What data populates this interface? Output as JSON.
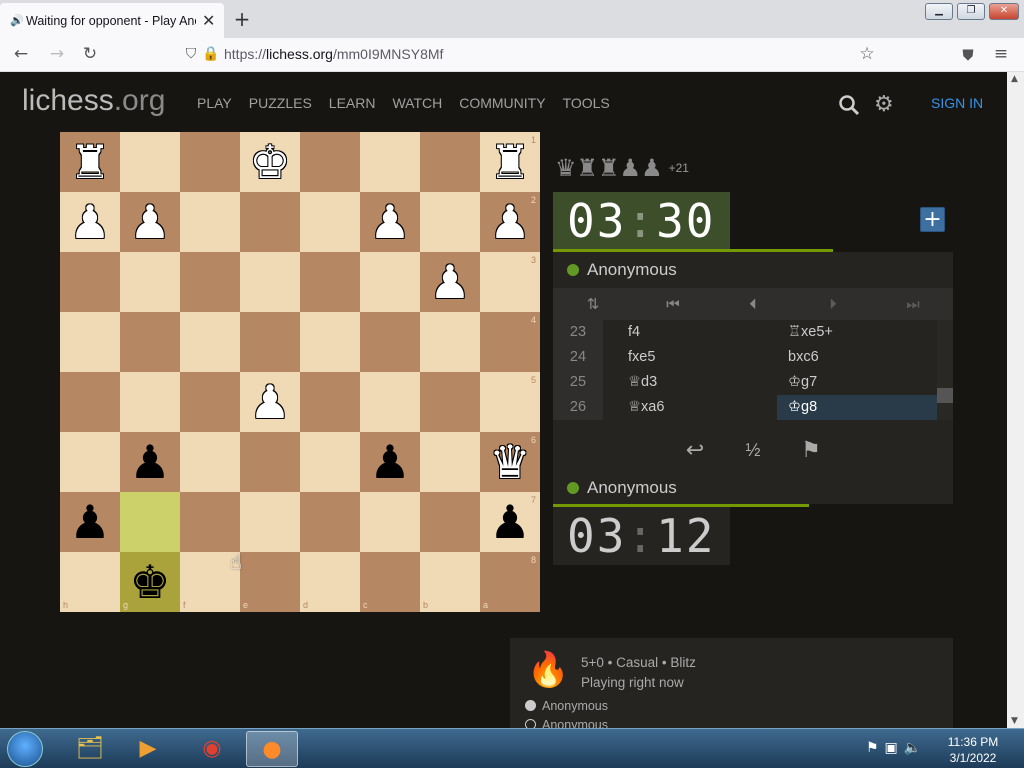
{
  "browser": {
    "tab_title": "Waiting for opponent - Play Anonymous",
    "new_tab": "+",
    "url_prefix": "https://",
    "url_domain": "lichess.org",
    "url_path": "/mm0I9MNSY8Mf",
    "window_buttons": [
      "minimize",
      "maximize",
      "close"
    ]
  },
  "site": {
    "logo_main": "lichess",
    "logo_domain": ".org",
    "nav": [
      "PLAY",
      "PUZZLES",
      "LEARN",
      "WATCH",
      "COMMUNITY",
      "TOOLS"
    ],
    "sign_in": "SIGN IN",
    "accent": "#3692e7"
  },
  "board": {
    "orientation": "black",
    "files_bottom": [
      "h",
      "g",
      "f",
      "e",
      "d",
      "c",
      "b",
      "a"
    ],
    "ranks_right": [
      "1",
      "2",
      "3",
      "4",
      "5",
      "6",
      "7",
      "8"
    ],
    "highlight_squares": [
      "g7",
      "g8"
    ],
    "pieces": [
      {
        "square": "h1",
        "glyph": "♜",
        "color": "white"
      },
      {
        "square": "e1",
        "glyph": "♚",
        "color": "white"
      },
      {
        "square": "a1",
        "glyph": "♜",
        "color": "white"
      },
      {
        "square": "h2",
        "glyph": "♟",
        "color": "white"
      },
      {
        "square": "g2",
        "glyph": "♟",
        "color": "white"
      },
      {
        "square": "c2",
        "glyph": "♟",
        "color": "white"
      },
      {
        "square": "a2",
        "glyph": "♟",
        "color": "white"
      },
      {
        "square": "b3",
        "glyph": "♟",
        "color": "white"
      },
      {
        "square": "e5",
        "glyph": "♟",
        "color": "white"
      },
      {
        "square": "a6",
        "glyph": "♛",
        "color": "white"
      },
      {
        "square": "g6",
        "glyph": "♟",
        "color": "black"
      },
      {
        "square": "c6",
        "glyph": "♟",
        "color": "black"
      },
      {
        "square": "h7",
        "glyph": "♟",
        "color": "black"
      },
      {
        "square": "a7",
        "glyph": "♟",
        "color": "black"
      },
      {
        "square": "g8",
        "glyph": "♚",
        "color": "black"
      }
    ]
  },
  "material": {
    "pieces": [
      "♛",
      "♜",
      "♜",
      "♟",
      "♟"
    ],
    "advantage": "+21"
  },
  "top_player": {
    "name": "Anonymous",
    "clock_min": "03",
    "clock_sec": "30",
    "time_fraction": 0.7
  },
  "bottom_player": {
    "name": "Anonymous",
    "clock_min": "03",
    "clock_sec": "12",
    "time_fraction": 0.64
  },
  "clock_separator": ":",
  "moves": [
    {
      "num": "23",
      "white": "f4",
      "black": "♖xe5+"
    },
    {
      "num": "24",
      "white": "fxe5",
      "black": "bxc6"
    },
    {
      "num": "25",
      "white": "♕d3",
      "black": "♔g7"
    },
    {
      "num": "26",
      "white": "♕xa6",
      "black": "♔g8"
    }
  ],
  "actions": {
    "takeback": "↩",
    "draw": "½",
    "resign": "⚑"
  },
  "game_info": {
    "line1": "5+0 • Casual • Blitz",
    "line2": "Playing right now",
    "players": [
      "Anonymous",
      "Anonymous"
    ]
  },
  "taskbar": {
    "time": "11:36 PM",
    "date": "3/1/2022"
  }
}
